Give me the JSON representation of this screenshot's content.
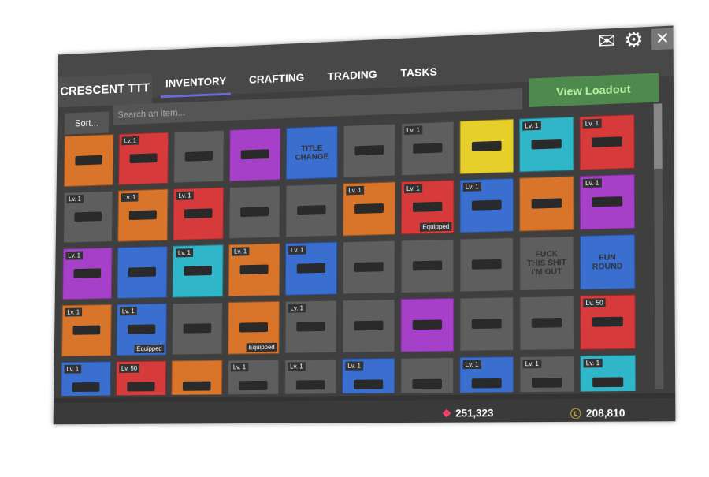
{
  "header": {
    "brand": "CRESCENT TTT",
    "tabs": [
      {
        "label": "INVENTORY",
        "active": true
      },
      {
        "label": "CRAFTING"
      },
      {
        "label": "TRADING"
      },
      {
        "label": "TASKS"
      }
    ],
    "icons": [
      "mail-icon",
      "gear-icon",
      "close-icon"
    ]
  },
  "toolbar": {
    "sort_label": "Sort...",
    "search_placeholder": "Search an item...",
    "loadout_label": "View Loadout",
    "loadout_color": "#4e8a4e"
  },
  "colors": {
    "orange": "#d9752b",
    "red": "#d63a3a",
    "gray": "#5e5e5e",
    "purple": "#a640c8",
    "blue": "#3a6fd0",
    "cyan": "#2fb6c8",
    "yellow": "#e6cf2a"
  },
  "items": [
    {
      "c": "orange"
    },
    {
      "c": "red",
      "lv": "Lv. 1"
    },
    {
      "c": "gray"
    },
    {
      "c": "purple"
    },
    {
      "c": "blue",
      "cap": "TITLE CHANGE"
    },
    {
      "c": "gray"
    },
    {
      "c": "gray",
      "lv": "Lv. 1"
    },
    {
      "c": "yellow"
    },
    {
      "c": "cyan",
      "lv": "Lv. 1"
    },
    {
      "c": "red",
      "lv": "Lv. 1"
    },
    {
      "c": "gray",
      "lv": "Lv. 1"
    },
    {
      "c": "orange",
      "lv": "Lv. 1"
    },
    {
      "c": "red",
      "lv": "Lv. 1"
    },
    {
      "c": "gray"
    },
    {
      "c": "gray"
    },
    {
      "c": "orange",
      "lv": "Lv. 1"
    },
    {
      "c": "red",
      "lv": "Lv. 1",
      "eq": "Equipped"
    },
    {
      "c": "blue",
      "lv": "Lv. 1"
    },
    {
      "c": "orange"
    },
    {
      "c": "purple",
      "lv": "Lv. 1"
    },
    {
      "c": "purple",
      "lv": "Lv. 1"
    },
    {
      "c": "blue"
    },
    {
      "c": "cyan",
      "lv": "Lv. 1"
    },
    {
      "c": "orange",
      "lv": "Lv. 1"
    },
    {
      "c": "blue",
      "lv": "Lv. 1"
    },
    {
      "c": "gray"
    },
    {
      "c": "gray"
    },
    {
      "c": "gray"
    },
    {
      "c": "gray",
      "cap": "FUCK THIS SHIT I'M OUT"
    },
    {
      "c": "blue",
      "cap": "FUN ROUND"
    },
    {
      "c": "orange",
      "lv": "Lv. 1"
    },
    {
      "c": "blue",
      "lv": "Lv. 1",
      "eq": "Equipped"
    },
    {
      "c": "gray"
    },
    {
      "c": "orange",
      "eq": "Equipped"
    },
    {
      "c": "gray",
      "lv": "Lv. 1"
    },
    {
      "c": "gray"
    },
    {
      "c": "purple"
    },
    {
      "c": "gray"
    },
    {
      "c": "gray"
    },
    {
      "c": "red",
      "lv": "Lv. 50"
    },
    {
      "c": "blue",
      "lv": "Lv. 1"
    },
    {
      "c": "red",
      "lv": "Lv. 50"
    },
    {
      "c": "orange"
    },
    {
      "c": "gray",
      "lv": "Lv. 1"
    },
    {
      "c": "gray",
      "lv": "Lv. 1"
    },
    {
      "c": "blue",
      "lv": "Lv. 1"
    },
    {
      "c": "gray"
    },
    {
      "c": "blue",
      "lv": "Lv. 1"
    },
    {
      "c": "gray",
      "lv": "Lv. 1"
    },
    {
      "c": "cyan",
      "lv": "Lv. 1"
    }
  ],
  "footer": {
    "gems": "251,323",
    "coins": "208,810",
    "gem_color": "#f0416a",
    "coin_color": "#c9a73a"
  }
}
